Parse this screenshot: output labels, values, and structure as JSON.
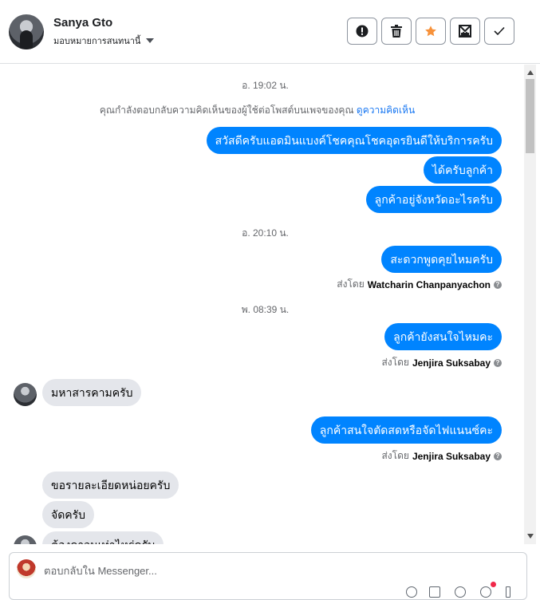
{
  "header": {
    "name": "Sanya Gto",
    "assign_label": "มอบหมายการสนทนานี้",
    "actions": [
      "spam-icon",
      "trash-icon",
      "star-icon",
      "mark-unread-icon",
      "done-icon"
    ],
    "star_color": "#f7923b"
  },
  "conversation": {
    "timestamps": [
      "อ. 19:02 น.",
      "อ. 20:10 น.",
      "พ. 08:39 น."
    ],
    "notice": {
      "text": "คุณกำลังตอบกลับความคิดเห็นของผู้ใช้ต่อโพสต์บนเพจของคุณ",
      "link": "ดูความคิดเห็น"
    },
    "messages": [
      {
        "dir": "out",
        "text": "สวัสดีครับแอดมินแบงค์โชคคุณโชคอุดรยินดีให้บริการครับ"
      },
      {
        "dir": "out",
        "text": "ได้ครับลูกค้า"
      },
      {
        "dir": "out",
        "text": "ลูกค้าอยู่จังหวัดอะไรครับ"
      },
      {
        "dir": "out",
        "text": "สะดวกพูดคุยไหมครับ"
      },
      {
        "dir": "out",
        "text": "ลูกค้ายังสนใจไหมคะ"
      },
      {
        "dir": "in",
        "text": "มหาสารคามครับ"
      },
      {
        "dir": "out",
        "text": "ลูกค้าสนใจตัดสดหรือจัดไฟแนนซ์คะ"
      },
      {
        "dir": "in",
        "text": "ขอรายละเอียดหน่อยครับ"
      },
      {
        "dir": "in",
        "text": "จัดครับ"
      },
      {
        "dir": "in",
        "text": "ต้องดาวนเท่าไหร่ครับ"
      }
    ],
    "sent_by": [
      {
        "prefix": "ส่งโดย",
        "name": "Watcharin Chanpanyachon"
      },
      {
        "prefix": "ส่งโดย",
        "name": "Jenjira Suksabay"
      },
      {
        "prefix": "ส่งโดย",
        "name": "Jenjira Suksabay"
      }
    ],
    "accent": "#0084ff"
  },
  "composer": {
    "placeholder": "ตอบกลับใน Messenger...",
    "value": ""
  }
}
